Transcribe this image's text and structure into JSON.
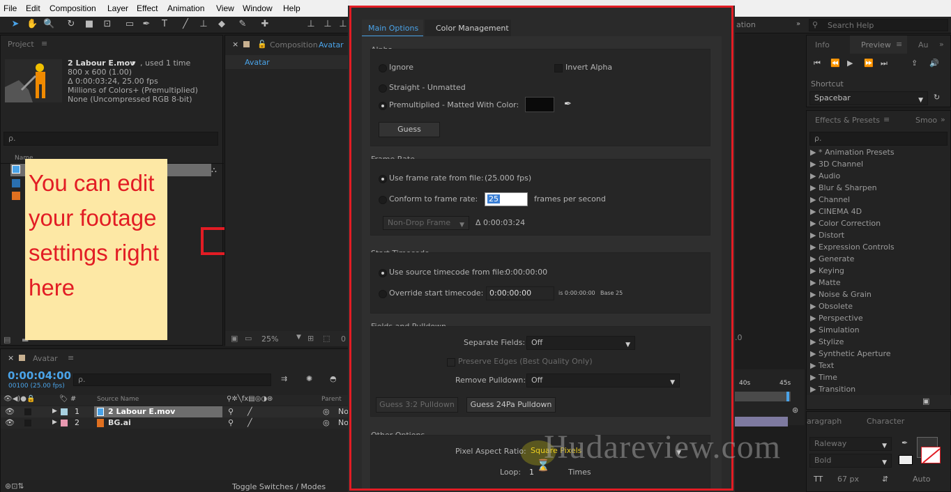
{
  "menu": [
    "File",
    "Edit",
    "Composition",
    "Layer",
    "Effect",
    "Animation",
    "View",
    "Window",
    "Help"
  ],
  "toolbar": {
    "workspace_frag": "ation",
    "search_help": "Search Help"
  },
  "project": {
    "tab": "Project",
    "footage_name": "2 Labour E.mov",
    "used": ", used 1 time",
    "dims": "800 x 600 (1.00)",
    "duration": "Δ 0:00:03:24, 25.00 fps",
    "colors": "Millions of Colors+ (Premultiplied)",
    "codec": "None (Uncompressed RGB 8-bit)",
    "search_placeholder": "ρ.",
    "name_col": "Name"
  },
  "composition": {
    "tab_prefix": "Composition",
    "tab_name": "Avatar",
    "subtab": "Avatar",
    "zoom": "25%",
    "frag": "0"
  },
  "callout": {
    "text": "You can edit your footage settings right here"
  },
  "timeline": {
    "tab": "Avatar",
    "timecode": "0:00:04:00",
    "frames": "00100 (25.00 fps)",
    "search_placeholder": "ρ.",
    "col_source": "Source Name",
    "col_parent": "Parent",
    "rows": [
      {
        "num": "1",
        "name": "2 Labour E.mov",
        "parent": "No"
      },
      {
        "num": "2",
        "name": "BG.ai",
        "parent": "No"
      }
    ],
    "toggle": "Toggle Switches / Modes",
    "ruler": [
      "40s",
      "45s"
    ],
    "frag": ".0"
  },
  "dialog": {
    "tabs": [
      "Main Options",
      "Color Management"
    ],
    "alpha": {
      "title": "Alpha",
      "ignore": "Ignore",
      "invert": "Invert Alpha",
      "straight": "Straight - Unmatted",
      "premult": "Premultiplied - Matted With Color:",
      "guess": "Guess",
      "matte_color": "#0a0a0a"
    },
    "frame_rate": {
      "title": "Frame Rate",
      "use_file": "Use frame rate from file:",
      "file_fps": "(25.000 fps)",
      "conform": "Conform to frame rate:",
      "conform_value": "25",
      "fps_label": "frames per second",
      "drop": "Non-Drop Frame",
      "duration": "Δ 0:00:03:24"
    },
    "timecode": {
      "title": "Start Timecode",
      "use_source": "Use source timecode from file:",
      "source_value": "0:00:00:00",
      "override": "Override start timecode:",
      "override_value": "0:00:00:00",
      "is_value": "is 0:00:00:00",
      "base": "Base 25"
    },
    "fields": {
      "title": "Fields and Pulldown",
      "separate": "Separate Fields:",
      "separate_value": "Off",
      "preserve": "Preserve Edges (Best Quality Only)",
      "remove": "Remove Pulldown:",
      "remove_value": "Off",
      "guess32": "Guess 3:2 Pulldown",
      "guess24": "Guess 24Pa Pulldown"
    },
    "other": {
      "title": "Other Options",
      "par": "Pixel Aspect Ratio:",
      "par_value": "Square Pixels",
      "loop": "Loop:",
      "loop_value": "1",
      "times": "Times"
    }
  },
  "info_panel": {
    "tabs": [
      "Info",
      "Preview",
      "Au"
    ],
    "shortcut_label": "Shortcut",
    "shortcut_value": "Spacebar"
  },
  "effects": {
    "tabs": [
      "Effects & Presets",
      "Smoo"
    ],
    "search_placeholder": "ρ.",
    "items": [
      "▶ * Animation Presets",
      "▶ 3D Channel",
      "▶ Audio",
      "▶ Blur & Sharpen",
      "▶ Channel",
      "▶ CINEMA 4D",
      "▶ Color Correction",
      "▶ Distort",
      "▶ Expression Controls",
      "▶ Generate",
      "▶ Keying",
      "▶ Matte",
      "▶ Noise & Grain",
      "▶ Obsolete",
      "▶ Perspective",
      "▶ Simulation",
      "▶ Stylize",
      "▶ Synthetic Aperture",
      "▶ Text",
      "▶ Time",
      "▶ Transition"
    ]
  },
  "character": {
    "tabs": [
      "aragraph",
      "Character"
    ],
    "font": "Raleway",
    "style": "Bold",
    "size": "67 px",
    "leading": "Auto"
  },
  "watermark": "Hudareview.com",
  "colors": {
    "accent_blue": "#4aa3e8",
    "callout_bg": "#fde8a5",
    "callout_text": "#e21c24",
    "highlight_frame": "#e21c24"
  }
}
